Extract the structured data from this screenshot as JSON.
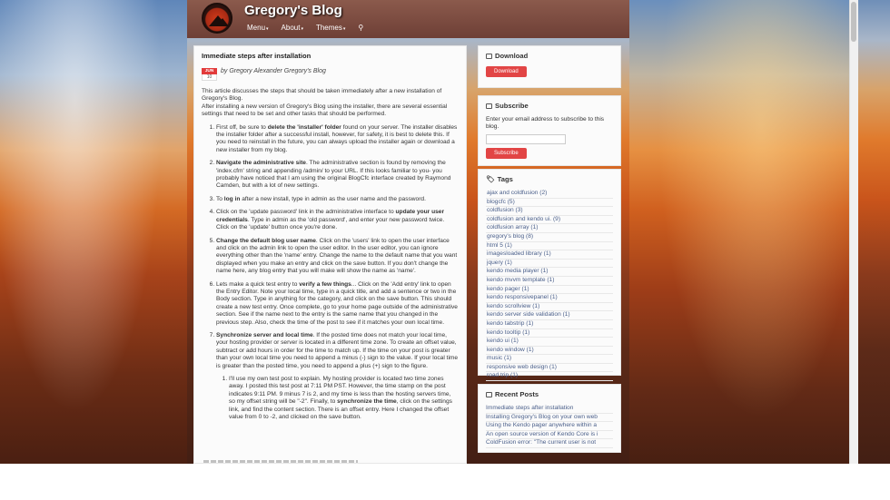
{
  "header": {
    "title": "Gregory's Blog",
    "nav": [
      {
        "label": "Menu",
        "caret": "▾"
      },
      {
        "label": "About",
        "caret": "▾"
      },
      {
        "label": "Themes",
        "caret": "▾"
      }
    ],
    "search_icon": "magnifier-icon"
  },
  "post": {
    "title": "Immediate steps after installation",
    "date_month": "JUN",
    "date_day": "10",
    "byline_prefix": "by",
    "byline_author": "Gregory Alexander Gregory's Blog",
    "intro_1": "This article discusses the steps that should be taken immediately after a new installation of Gregory's Blog.",
    "intro_2": "After installing a new version of Gregory's Blog using the installer, there are several essential settings that need to be set and other tasks that should be performed.",
    "steps": [
      {
        "pre": "First off, be sure to ",
        "bold": "delete the 'installer' folder",
        "post": " found on your server. The installer disables the installer folder after a successful install, however, for safety, it is best to delete this. If you need to reinstall in the future, you can always upload the installer again or download a new installer from my blog."
      },
      {
        "pre": "",
        "bold": "Navigate the administrative site",
        "post": ". The administrative section is found by removing the 'index.cfm' string and appending /admin/ to your URL. If this looks familiar to you- you probably have noticed that I am using the original BlogCfc interface created by Raymond Camden, but with a lot of new settings."
      },
      {
        "pre": "To ",
        "bold": "log in",
        "post": " after a new install, type in admin as the user name and the password."
      },
      {
        "pre": "Click on the 'update password' link in the administrative interface to ",
        "bold": "update your user credentials",
        "post": ". Type in admin as the 'old password', and enter your new password twice. Click on the 'update' button once you're done."
      },
      {
        "pre": "",
        "bold": "Change the default blog user name",
        "post": ". Click on the 'users' link to open the user interface and click on the admin link to open the user editor. In the user editor, you can ignore everything other than the 'name' entry. Change the name to the default name that you want displayed when you make an entry and click on the save button. If you don't change the name here, any blog entry that you will make will show the name as 'name'."
      },
      {
        "pre": "Lets make a quick test entry to ",
        "bold": "verify a few things",
        "post": "... Click on the 'Add entry' link to open the Entry Editor. Note your local time, type in a quick title, and add a sentence or two in the Body section. Type in anything for the category, and click on the save button. This should create a new test entry. Once complete, go to your home page outside of the administrative section. See if the name next to the entry is the same name that you changed in the previous step. Also, check the time of the post to see if it matches your own local time."
      },
      {
        "pre": "",
        "bold": "Synchronize server and local time",
        "post": ". If the posted time does not match your local time, your hosting provider or server is located in a different time zone. To create an offset value, subtract or add hours in order for the time to match up. If the time on your post is greater than your own local time you need to append a minus (-) sign to the value. If your local time is greater than the posted time, you need to append a plus (+) sign to the figure."
      }
    ],
    "substep": {
      "pre": "I'll use my own test post to explain. My hosting provider is located two time zones away. I posted this test post at 7:11 PM PST. However, the time stamp on the post indicates 9:11 PM. 9 minus 7 is 2, and my time is less than the hosting servers time, so my offset string will be \"-2\". Finally, to ",
      "bold": "synchronize the time",
      "post": ", click on the settings link, and find the content section. There is an offset entry. Here I changed the offset value from 0 to -2, and clicked on the save button."
    }
  },
  "download": {
    "title": "Download",
    "icon": "download-icon",
    "button": "Download"
  },
  "subscribe": {
    "title": "Subscribe",
    "icon": "envelope-icon",
    "text": "Enter your email address to subscribe to this blog.",
    "input_placeholder": "",
    "button": "Subscribe"
  },
  "tags": {
    "title": "Tags",
    "icon": "tags-icon",
    "items": [
      "ajax and coldfusion (2)",
      "blogcfc (5)",
      "coldfusion (3)",
      "coldfusion and kendo ui. (9)",
      "coldfusion array (1)",
      "gregory's blog (8)",
      "html 5 (1)",
      "imagesloaded library (1)",
      "jquery (1)",
      "kendo media player (1)",
      "kendo mvvm template (1)",
      "kendo pager (1)",
      "kendo responsivepanel (1)",
      "kendo scrollview (1)",
      "kendo server side validation (1)",
      "kendo tabstrip (1)",
      "kendo tooltip (1)",
      "kendo ui (1)",
      "kendo window (1)",
      "music (1)",
      "responsive web design (1)",
      "road trip (1)"
    ]
  },
  "recent": {
    "title": "Recent Posts",
    "icon": "calendar-icon",
    "items": [
      "Immediate steps after installation",
      "Installing Gregory's Blog on your own web",
      "Using the Kendo pager anywhere within a",
      "An open source version of Kendo Core is i",
      "ColdFusion error: \"The current user is not"
    ]
  }
}
